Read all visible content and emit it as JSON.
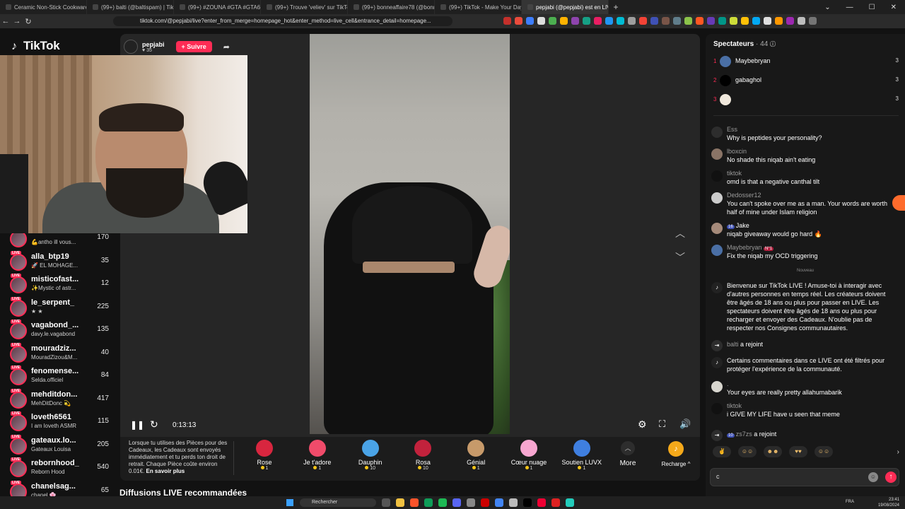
{
  "browser": {
    "tabs": [
      {
        "title": "Ceramic Non-Stick Cookware: Non-T",
        "active": false
      },
      {
        "title": "(99+) balti (@baltispam) | TikTok",
        "active": false
      },
      {
        "title": "(99+) #ZOUNA #GTA #GTA6 #TRMLE",
        "active": false
      },
      {
        "title": "(99+) Trouve 'veliev' sur TikTok | Re",
        "active": false
      },
      {
        "title": "(99+) bonneaffaire78 (@bonneaffaire",
        "active": false
      },
      {
        "title": "(99+) TikTok - Make Your Day",
        "active": false
      },
      {
        "title": "pepjabi (@pepjabi) est en LIVE",
        "active": true
      }
    ],
    "url": "tiktok.com/@pepjabi/live?enter_from_merge=homepage_hot&enter_method=live_cell&entrance_detail=homepage..."
  },
  "header": {
    "logo_text": "TikTok"
  },
  "host": {
    "name": "pepjabi",
    "likes": "35",
    "follow_label": "+ Suivre"
  },
  "following": [
    {
      "name": "",
      "sub": "💪antho ill vous...",
      "count": "170"
    },
    {
      "name": "alla_btp19",
      "sub": "🚀 EL MOHAGE...",
      "count": "35"
    },
    {
      "name": "misticofast...",
      "sub": "✨Mystic of astr...",
      "count": "12"
    },
    {
      "name": "le_serpent_",
      "sub": "★ ★",
      "count": "225"
    },
    {
      "name": "vagabond_...",
      "sub": "davy.le.vagabond",
      "count": "135"
    },
    {
      "name": "mouradziz...",
      "sub": "MouradZizou&M...",
      "count": "40"
    },
    {
      "name": "fenomense...",
      "sub": "Selda.officiel",
      "count": "84"
    },
    {
      "name": "mehditdon...",
      "sub": "MehDitDonc 💫",
      "count": "417"
    },
    {
      "name": "loveth6561",
      "sub": "I am loveth ASMR",
      "count": "115"
    },
    {
      "name": "gateaux.lo...",
      "sub": "Gateaux Louisa",
      "count": "205"
    },
    {
      "name": "rebornhood_",
      "sub": "Reborn Hood",
      "count": "540"
    },
    {
      "name": "chanelsag...",
      "sub": "chanel 🌸",
      "count": "65"
    }
  ],
  "player": {
    "time": "0:13:13"
  },
  "gifts": {
    "info_text": "Lorsque tu utilises des Pièces pour des Cadeaux, les Cadeaux sont envoyés immédiatement et tu perds ton droit de retrait. Chaque Pièce coûte environ 0.01€.",
    "info_link": "En savoir plus",
    "items": [
      {
        "name": "Rose",
        "price": "1",
        "color": "#d8263f"
      },
      {
        "name": "Je t'adore",
        "price": "1",
        "color": "#f04b6a"
      },
      {
        "name": "Dauphin",
        "price": "10",
        "color": "#4aa3e6"
      },
      {
        "name": "Rosa",
        "price": "10",
        "color": "#c2223c"
      },
      {
        "name": "Génial",
        "price": "1",
        "color": "#c79a6a"
      },
      {
        "name": "Cœur nuage",
        "price": "1",
        "color": "#f7a6d0"
      },
      {
        "name": "Soutien LUVX",
        "price": "1",
        "color": "#3f7fe0"
      }
    ],
    "more_label": "More",
    "recharge_label": "Recharge"
  },
  "recommended_label": "Diffusions LIVE recommandées",
  "chat": {
    "spectators_label": "Spectateurs",
    "spectators_count": "· 44",
    "ranking": [
      {
        "rank": "1",
        "name": "Maybebryan",
        "score": "3"
      },
      {
        "rank": "2",
        "name": "gabaghol",
        "score": "3"
      },
      {
        "rank": "3",
        "name": "",
        "score": "3"
      }
    ],
    "messages": [
      {
        "user": "Ess",
        "text": "Why is peptides your personality?"
      },
      {
        "user": "lboxcin",
        "text": "No shade this niqab ain't eating"
      },
      {
        "user": "tiktok",
        "text": "omd is that a negative canthal tilt"
      },
      {
        "user": "Dedosser12",
        "text": "You can't spoke over me as a man. Your words are worth half of mine under Islam religion"
      },
      {
        "user": "Jake",
        "badge": "16",
        "text": "niqab giveaway would go hard 🔥"
      },
      {
        "user": "Maybebryan",
        "badge": "N°1",
        "text": "Fix the niqab my OCD triggering"
      }
    ],
    "new_label": "Nouveau",
    "system_welcome": "Bienvenue sur TikTok LIVE ! Amuse-toi à interagir avec d'autres personnes en temps réel. Les créateurs doivent être âgés de 18 ans ou plus pour passer en LIVE. Les spectateurs doivent être âgés de 18 ans ou plus pour recharger et envoyer des Cadeaux. N'oublie pas de respecter nos Consignes communautaires.",
    "join1_user": "balti",
    "join1_text": "a rejoint",
    "system_filter": "Certains commentaires dans ce LIVE ont été filtrés pour protéger l'expérience de la communauté.",
    "msg_pretty": {
      "user": ".",
      "text": "Your eyes are really pretty allahumabarik"
    },
    "msg_life": {
      "user": "tiktok",
      "text": "i GIVE MY LIFE have u seen that meme"
    },
    "join2_badge": "10",
    "join2_user": "zs7zs",
    "join2_text": "a rejoint",
    "input_value": "c"
  },
  "taskbar": {
    "search_label": "Rechercher",
    "lang": "FRA",
    "time": "23:41",
    "date": "19/08/2024"
  }
}
